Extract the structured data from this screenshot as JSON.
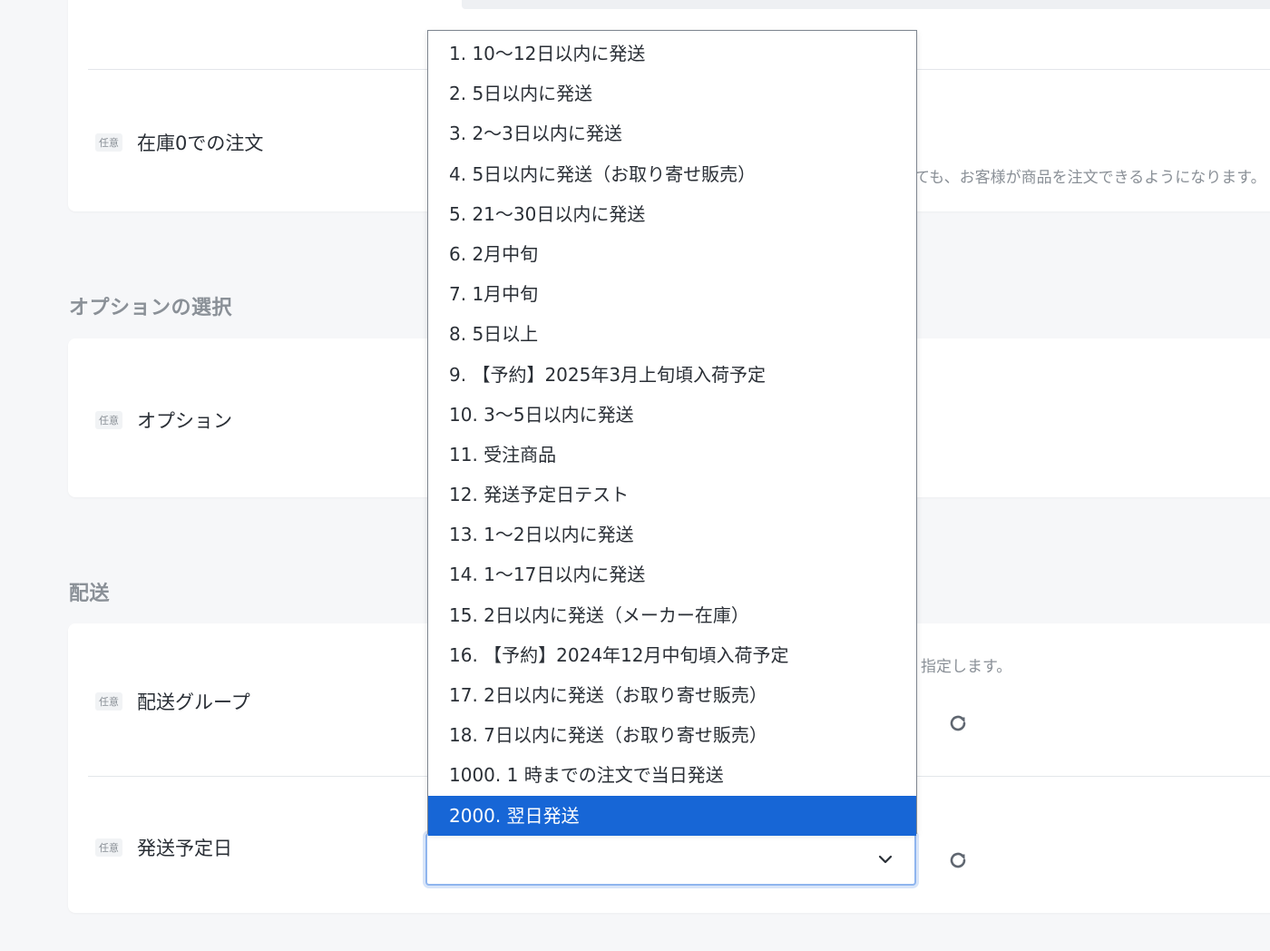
{
  "sections": {
    "options_title": "オプションの選択",
    "shipping_title": "配送"
  },
  "rows": {
    "stock_zero": {
      "badge": "任意",
      "label": "在庫0での注文",
      "help": "ても、お客様が商品を注文できるようになります。"
    },
    "option": {
      "badge": "任意",
      "label": "オプション"
    },
    "shipping_group": {
      "badge": "任意",
      "label": "配送グループ",
      "help": "指定します。"
    },
    "ship_date": {
      "badge": "任意",
      "label": "発送予定日"
    }
  },
  "dropdown": {
    "options": [
      "1. 10〜12日以内に発送",
      "2. 5日以内に発送",
      "3. 2〜3日以内に発送",
      "4. 5日以内に発送（お取り寄せ販売）",
      "5. 21〜30日以内に発送",
      "6. 2月中旬",
      "7. 1月中旬",
      "8. 5日以上",
      "9. 【予約】2025年3月上旬頃入荷予定",
      "10. 3〜5日以内に発送",
      "11. 受注商品",
      "12. 発送予定日テスト",
      "13. 1〜2日以内に発送",
      "14. 1〜17日以内に発送",
      "15. 2日以内に発送（メーカー在庫）",
      "16. 【予約】2024年12月中旬頃入荷予定",
      "17. 2日以内に発送（お取り寄せ販売）",
      "18. 7日以内に発送（お取り寄せ販売）",
      "1000. 1 時までの注文で当日発送",
      "2000. 翌日発送"
    ],
    "highlighted_index": 19
  },
  "colors": {
    "highlight": "#1766d6",
    "focus_border": "#8fb5ee",
    "muted_text": "#8a9097"
  },
  "icons": {
    "reset": "refresh-icon",
    "chevron": "chevron-down-icon"
  }
}
